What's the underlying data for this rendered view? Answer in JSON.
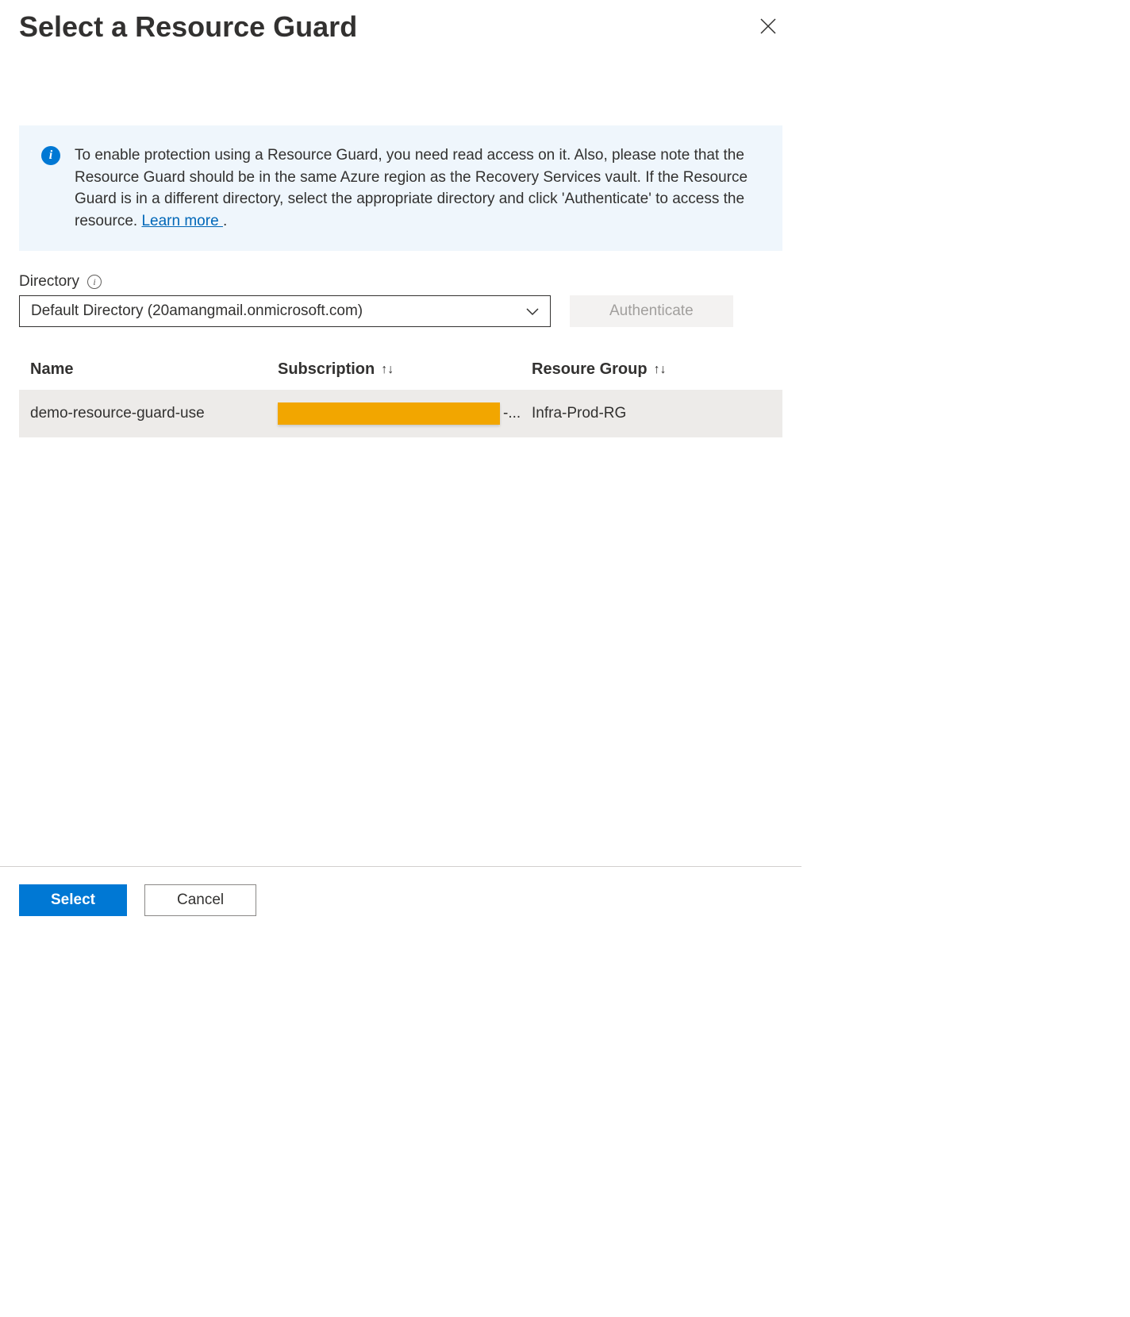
{
  "header": {
    "title": "Select a Resource Guard"
  },
  "infobox": {
    "text": "To enable protection using a Resource Guard, you need read access on it. Also, please note that the Resource Guard should be in the same Azure region as the Recovery Services vault. If the Resource Guard is in a different directory, select the appropriate directory and click 'Authenticate' to access the resource. ",
    "learn_more_label": "Learn more ",
    "trailing": "."
  },
  "directory": {
    "label": "Directory",
    "selected": "Default Directory (20amangmail.onmicrosoft.com)",
    "authenticate_label": "Authenticate"
  },
  "table": {
    "columns": {
      "name": "Name",
      "subscription": "Subscription",
      "resource_group": "Resoure Group"
    },
    "rows": [
      {
        "name": "demo-resource-guard-use",
        "subscription_suffix": "-...",
        "resource_group": "Infra-Prod-RG"
      }
    ]
  },
  "footer": {
    "select_label": "Select",
    "cancel_label": "Cancel"
  }
}
